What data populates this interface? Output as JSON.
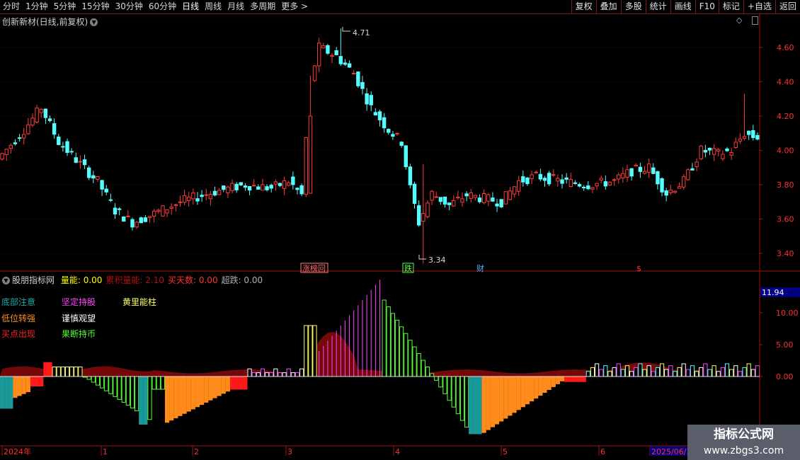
{
  "toolbar": {
    "periods": [
      "分时",
      "1分钟",
      "5分钟",
      "15分钟",
      "30分钟",
      "60分钟",
      "日线",
      "周线",
      "月线",
      "多周期",
      "更多 >"
    ],
    "active_period": "日线",
    "right_buttons": [
      "复权",
      "叠加",
      "多股",
      "统计",
      "画线",
      "F10",
      "标记",
      "+自选",
      "返回"
    ]
  },
  "main_chart": {
    "title": "创新新材(日线,前复权)",
    "y_ticks": [
      "4.60",
      "4.40",
      "4.20",
      "4.00",
      "3.80",
      "3.60",
      "3.40"
    ],
    "high_label": "4.71",
    "low_label": "3.34",
    "event_markers": [
      "涨榜回",
      "跌",
      "财",
      "$"
    ],
    "colors": {
      "up": "#ff3b3b",
      "down": "#54ffff",
      "axis": "#a01414"
    }
  },
  "indicator": {
    "title": "股朋指标网",
    "fields": [
      {
        "label": "量能:",
        "value": "0.00",
        "color": "#ffff00"
      },
      {
        "label": "累积量能:",
        "value": "2.10",
        "color": "#b01010"
      },
      {
        "label": "买天数:",
        "value": "0.00",
        "color": "#ff3030"
      },
      {
        "label": "超跌:",
        "value": "0.00",
        "color": "#b0b0b0"
      }
    ],
    "legend": [
      {
        "text": "底部注意",
        "color": "#1faaaa"
      },
      {
        "text": "坚定持股",
        "color": "#ff44ff"
      },
      {
        "text": "黄里能柱",
        "color": "#ffff66"
      },
      {
        "text": "低位转强",
        "color": "#ff8c1a"
      },
      {
        "text": "谨慎观望",
        "color": "#ffffff"
      },
      {
        "text": "买点出现",
        "color": "#ff2020"
      },
      {
        "text": "果断持币",
        "color": "#55ff33"
      }
    ],
    "y_ticks": [
      "10.00",
      "5.00",
      "0.00"
    ],
    "current_value": "11.94"
  },
  "time_axis": {
    "labels": [
      "2024年",
      "1",
      "2",
      "3",
      "4",
      "5",
      "6",
      "2025/06/1"
    ]
  },
  "watermark": {
    "line1": "指标公式网",
    "line2": "www.zbgs3.com"
  }
}
